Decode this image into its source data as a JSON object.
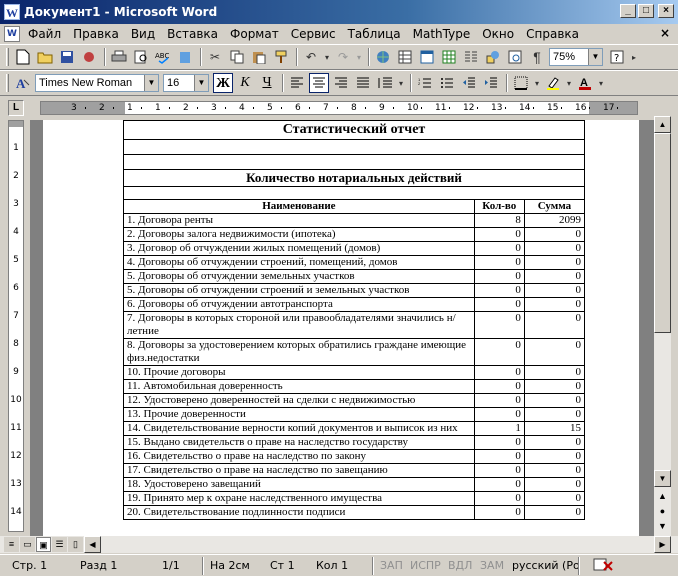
{
  "window": {
    "title": "Документ1 - Microsoft Word",
    "app_icon": "W",
    "buttons": [
      "_",
      "□",
      "×"
    ]
  },
  "menu": {
    "items": [
      "Файл",
      "Правка",
      "Вид",
      "Вставка",
      "Формат",
      "Сервис",
      "Таблица",
      "MathType",
      "Окно",
      "Справка"
    ],
    "close": "×"
  },
  "toolbar_standard": {
    "zoom": "75%"
  },
  "toolbar_formatting": {
    "font": "Times New Roman",
    "size": "16",
    "bold": "Ж",
    "italic": "К",
    "underline": "Ч"
  },
  "ruler": {
    "tab_selector": "L",
    "h_numbers": [
      "3",
      "2",
      "1",
      "1",
      "2",
      "3",
      "4",
      "5",
      "6",
      "7",
      "8",
      "9",
      "10",
      "11",
      "12",
      "13",
      "14",
      "15",
      "16",
      "17"
    ],
    "v_numbers": [
      "1",
      "2",
      "3",
      "4",
      "5",
      "6",
      "7",
      "8",
      "9",
      "10",
      "11",
      "12",
      "13",
      "14"
    ]
  },
  "document": {
    "title": "Статистический отчет",
    "subtitle": "Количество нотариальных действий",
    "columns": [
      "Наименование",
      "Кол-во",
      "Сумма"
    ],
    "rows": [
      {
        "name": "1. Договора ренты",
        "count": "8",
        "sum": "2099"
      },
      {
        "name": "2. Договоры залога недвижимости (ипотека)",
        "count": "0",
        "sum": "0"
      },
      {
        "name": "3. Договор об отчуждении жилых помещений (домов)",
        "count": "0",
        "sum": "0"
      },
      {
        "name": "4. Договоры об отчуждении строений, помещений, домов",
        "count": "0",
        "sum": "0"
      },
      {
        "name": "5. Договоры об отчуждении земельных участков",
        "count": "0",
        "sum": "0"
      },
      {
        "name": "5. Договоры об отчуждении строений и земельных участков",
        "count": "0",
        "sum": "0"
      },
      {
        "name": "6. Договоры об отчуждении автотранспорта",
        "count": "0",
        "sum": "0"
      },
      {
        "name": "7. Договоры в которых стороной или правообладателями значились н/летние",
        "count": "0",
        "sum": "0"
      },
      {
        "name": "8. Договоры за удостоверением которых обратились граждане имеющие физ.недостатки",
        "count": "0",
        "sum": "0"
      },
      {
        "name": "10. Прочие договоры",
        "count": "0",
        "sum": "0"
      },
      {
        "name": "11. Автомобильная доверенность",
        "count": "0",
        "sum": "0"
      },
      {
        "name": "12. Удостоверено доверенностей на сделки с недвижимостью",
        "count": "0",
        "sum": "0"
      },
      {
        "name": "13. Прочие доверенности",
        "count": "0",
        "sum": "0"
      },
      {
        "name": "14. Свидетельствование верности копий документов и выписок из них",
        "count": "1",
        "sum": "15"
      },
      {
        "name": "15. Выдано свидетельств о праве на наследство государству",
        "count": "0",
        "sum": "0"
      },
      {
        "name": "16. Свидетельство о праве на наследство по закону",
        "count": "0",
        "sum": "0"
      },
      {
        "name": "17. Свидетельство о праве на наследство по завещанию",
        "count": "0",
        "sum": "0"
      },
      {
        "name": "18. Удостоверено завещаний",
        "count": "0",
        "sum": "0"
      },
      {
        "name": "19. Принято мер к охране наследственного имущества",
        "count": "0",
        "sum": "0"
      },
      {
        "name": "20. Свидетельствование подлинности подписи",
        "count": "0",
        "sum": "0"
      }
    ]
  },
  "status": {
    "page": "Стр. 1",
    "section": "Разд 1",
    "pages": "1/1",
    "at": "На 2см",
    "line": "Ст 1",
    "col": "Кол 1",
    "rec": "ЗАП",
    "trk": "ИСПР",
    "ext": "ВДЛ",
    "ovr": "ЗАМ",
    "lang": "русский (Ро"
  }
}
